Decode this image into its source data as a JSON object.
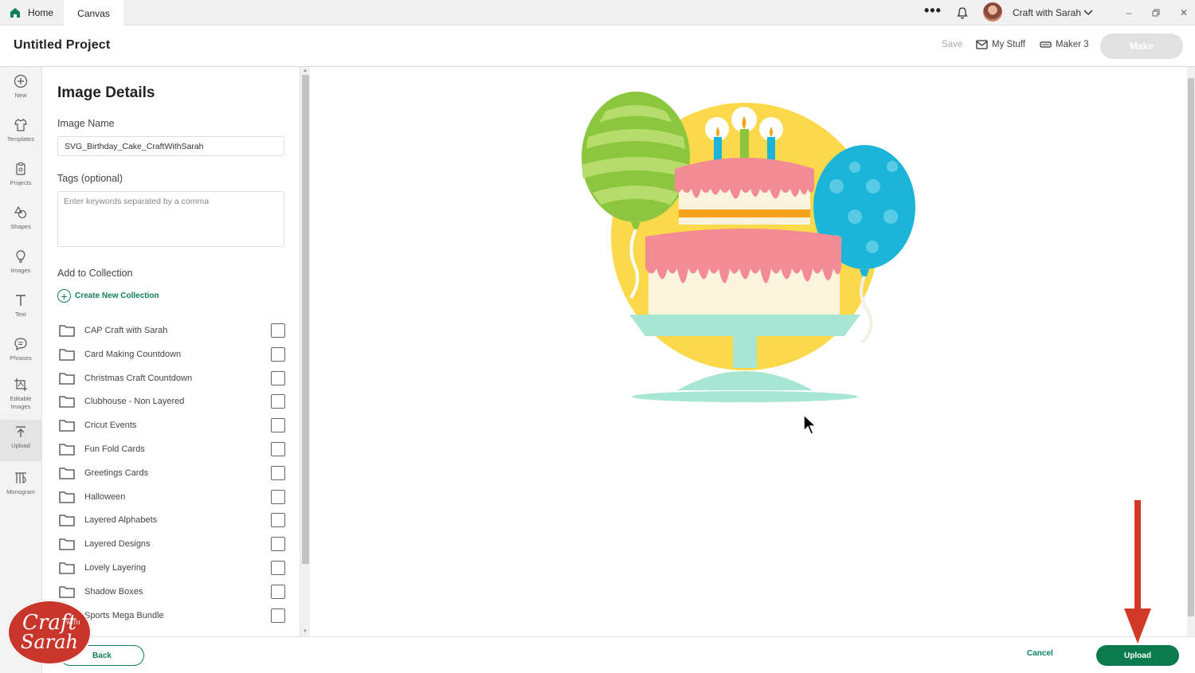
{
  "titlebar": {
    "tabs": [
      {
        "label": "Home"
      },
      {
        "label": "Canvas"
      }
    ],
    "user_name": "Craft with Sarah"
  },
  "header": {
    "project_title": "Untitled Project",
    "save_label": "Save",
    "mystuff_label": "My Stuff",
    "machine_label": "Maker 3",
    "make_label": "Make"
  },
  "sidebar": {
    "items": [
      {
        "label": "New",
        "icon": "plus-circle-icon"
      },
      {
        "label": "Templates",
        "icon": "shirt-icon"
      },
      {
        "label": "Projects",
        "icon": "projects-icon"
      },
      {
        "label": "Shapes",
        "icon": "shapes-icon"
      },
      {
        "label": "Images",
        "icon": "lightbulb-icon"
      },
      {
        "label": "Text",
        "icon": "text-icon"
      },
      {
        "label": "Phrases",
        "icon": "speech-bubble-icon"
      },
      {
        "label": "Editable Images",
        "icon": "editable-images-icon"
      },
      {
        "label": "Upload",
        "icon": "upload-icon"
      },
      {
        "label": "Monogram",
        "icon": "monogram-icon"
      }
    ],
    "active_item": "Upload"
  },
  "details": {
    "title": "Image Details",
    "image_name_label": "Image Name",
    "image_name_value": "SVG_Birthday_Cake_CraftWithSarah",
    "tags_label": "Tags (optional)",
    "tags_placeholder": "Enter keywords separated by a comma",
    "collection_label": "Add to Collection",
    "create_collection_label": "Create New Collection",
    "collections": [
      {
        "name": "CAP Craft with Sarah",
        "checked": false
      },
      {
        "name": "Card Making Countdown",
        "checked": false
      },
      {
        "name": "Christmas Craft Countdown",
        "checked": false
      },
      {
        "name": "Clubhouse - Non Layered",
        "checked": false
      },
      {
        "name": "Cricut Events",
        "checked": false
      },
      {
        "name": "Fun Fold Cards",
        "checked": false
      },
      {
        "name": "Greetings Cards",
        "checked": false
      },
      {
        "name": "Halloween",
        "checked": false
      },
      {
        "name": "Layered Alphabets",
        "checked": false
      },
      {
        "name": "Layered Designs",
        "checked": false
      },
      {
        "name": "Lovely Layering",
        "checked": false
      },
      {
        "name": "Shadow Boxes",
        "checked": false
      },
      {
        "name": "Sports Mega Bundle",
        "checked": false
      }
    ]
  },
  "footer": {
    "back_label": "Back",
    "cancel_label": "Cancel",
    "upload_label": "Upload"
  },
  "overlay": {
    "logo_line1": "Craft",
    "logo_with": "WITH",
    "logo_line2": "Sarah"
  },
  "colors": {
    "brand_green": "#0c7a4f",
    "arrow_red": "#d03a27",
    "logo_red": "#c8362b"
  }
}
